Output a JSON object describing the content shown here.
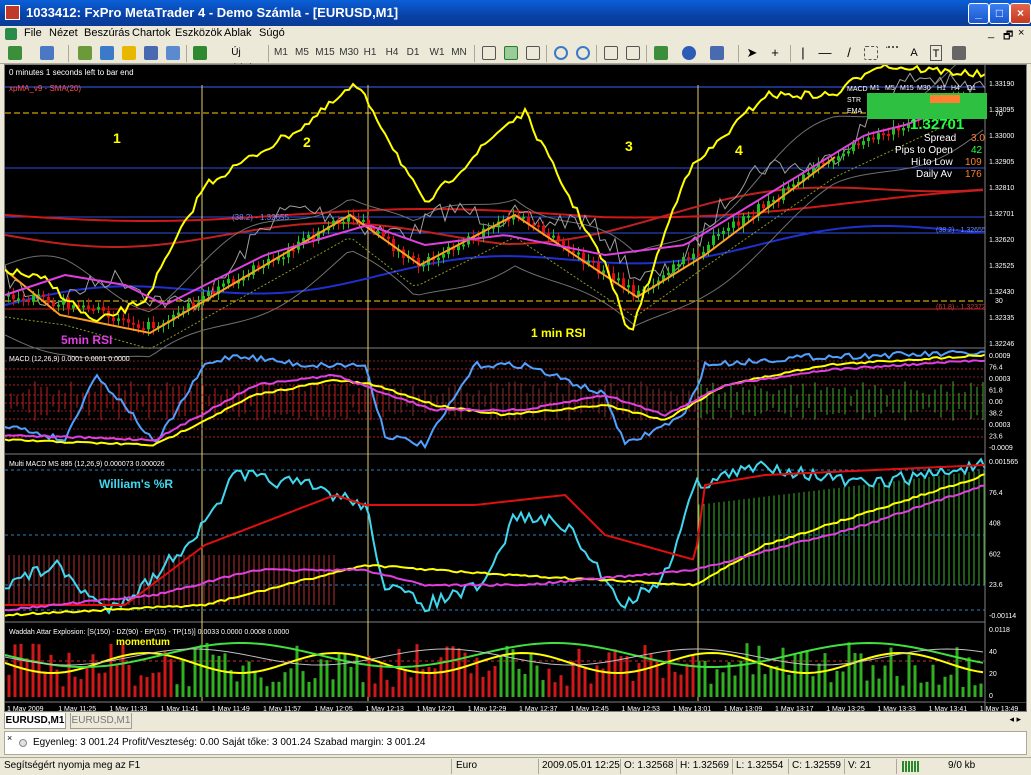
{
  "window": {
    "title": "1033412: FxPro MetaTrader 4 - Demo Számla - [EURUSD,M1]",
    "btn_min": "_",
    "btn_max": "□",
    "btn_close": "×",
    "mdi_min": "_",
    "mdi_restore": "🗗",
    "mdi_close": "×"
  },
  "menu": [
    "File",
    "Nézet",
    "Beszúrás",
    "Chartok",
    "Eszközök",
    "Ablak",
    "Súgó"
  ],
  "toolbar": {
    "new_order": "Új megbízás",
    "timeframes": [
      "M1",
      "M5",
      "M15",
      "M30",
      "H1",
      "H4",
      "D1",
      "W1",
      "MN"
    ]
  },
  "main_chart": {
    "timer": "0 minutes 1 seconds left to bar end",
    "indicator": "xpMA_v9 - SMA(20)",
    "phase_labels": [
      "1",
      "2",
      "3",
      "4"
    ],
    "rsi5_label": "5min RSI",
    "rsi1_label": "1 min RSI",
    "price_big": "1.32701",
    "info_rows": [
      {
        "label": "Spread",
        "value": "3.0"
      },
      {
        "label": "Pips to Open",
        "value": "42"
      },
      {
        "label": "Hi to Low",
        "value": "109"
      },
      {
        "label": "Daily Av",
        "value": "176"
      }
    ],
    "mtf_header": [
      "M1",
      "M5",
      "M15",
      "M30",
      "H1",
      "H4",
      "D1"
    ],
    "mtf_rows": [
      "MACD",
      "STR",
      "EMA"
    ],
    "fib_upper": "(38.2) - 1.32655",
    "fib_lower": "(61.8) - 1.32372",
    "level_70": "70",
    "level_30": "30",
    "price_axis": [
      "1.33190",
      "1.33095",
      "1.33000",
      "1.32905",
      "1.32810",
      "1.32701",
      "1.32620",
      "1.32525",
      "1.32430",
      "1.32335",
      "1.32246"
    ]
  },
  "macd_panel": {
    "title": "MACD (12,26,9) 0.0001 0.0001 0.0000",
    "axis": [
      "0.0009",
      "76.4",
      "0.0003",
      "61.8",
      "0.00",
      "38.2",
      "0.0003",
      "23.6",
      "-0.0009"
    ]
  },
  "multi_macd_panel": {
    "title": "Multi MACD MS 895 (12,26,9) 0.000073 0.000026",
    "label": "William's %R",
    "axis": [
      "0.001565",
      "76.4",
      "408",
      "602",
      "23.6",
      "-0.00114"
    ]
  },
  "waddah_panel": {
    "title": "Waddah Attar Explosion: [S(150) - DZ(90) - EP(15) - TP(15)] 0.0033 0.0000 0.0008 0.0000",
    "label": "momentum",
    "axis": [
      "0.0118",
      "40",
      "20",
      "0"
    ]
  },
  "time_axis": [
    "1 May 2009",
    "1 May 11:25",
    "1 May 11:33",
    "1 May 11:41",
    "1 May 11:49",
    "1 May 11:57",
    "1 May 12:05",
    "1 May 12:13",
    "1 May 12:21",
    "1 May 12:29",
    "1 May 12:37",
    "1 May 12:45",
    "1 May 12:53",
    "1 May 13:01",
    "1 May 13:09",
    "1 May 13:17",
    "1 May 13:25",
    "1 May 13:33",
    "1 May 13:41",
    "1 May 13:49"
  ],
  "tabs": [
    "EURUSD,M1",
    "EURUSD,M1"
  ],
  "terminal": {
    "text": "Egyenleg: 3 001.24  Profit/Veszteség: 0.00  Saját tőke: 3 001.24  Szabad margin: 3 001.24"
  },
  "status": {
    "help": "Segítségért nyomja meg az F1",
    "profile": "Euro",
    "datetime": "2009.05.01 12:25",
    "open": "O: 1.32568",
    "high": "H: 1.32569",
    "low": "L: 1.32554",
    "close": "C: 1.32559",
    "volume": "V: 21",
    "traffic": "9/0 kb"
  },
  "colors": {
    "title_bg": "#0842a6",
    "chart_bg": "#000000",
    "bull": "#22c020",
    "bear": "#e01010",
    "accent_yellow": "#ffff00",
    "accent_orange": "#ffa500"
  }
}
